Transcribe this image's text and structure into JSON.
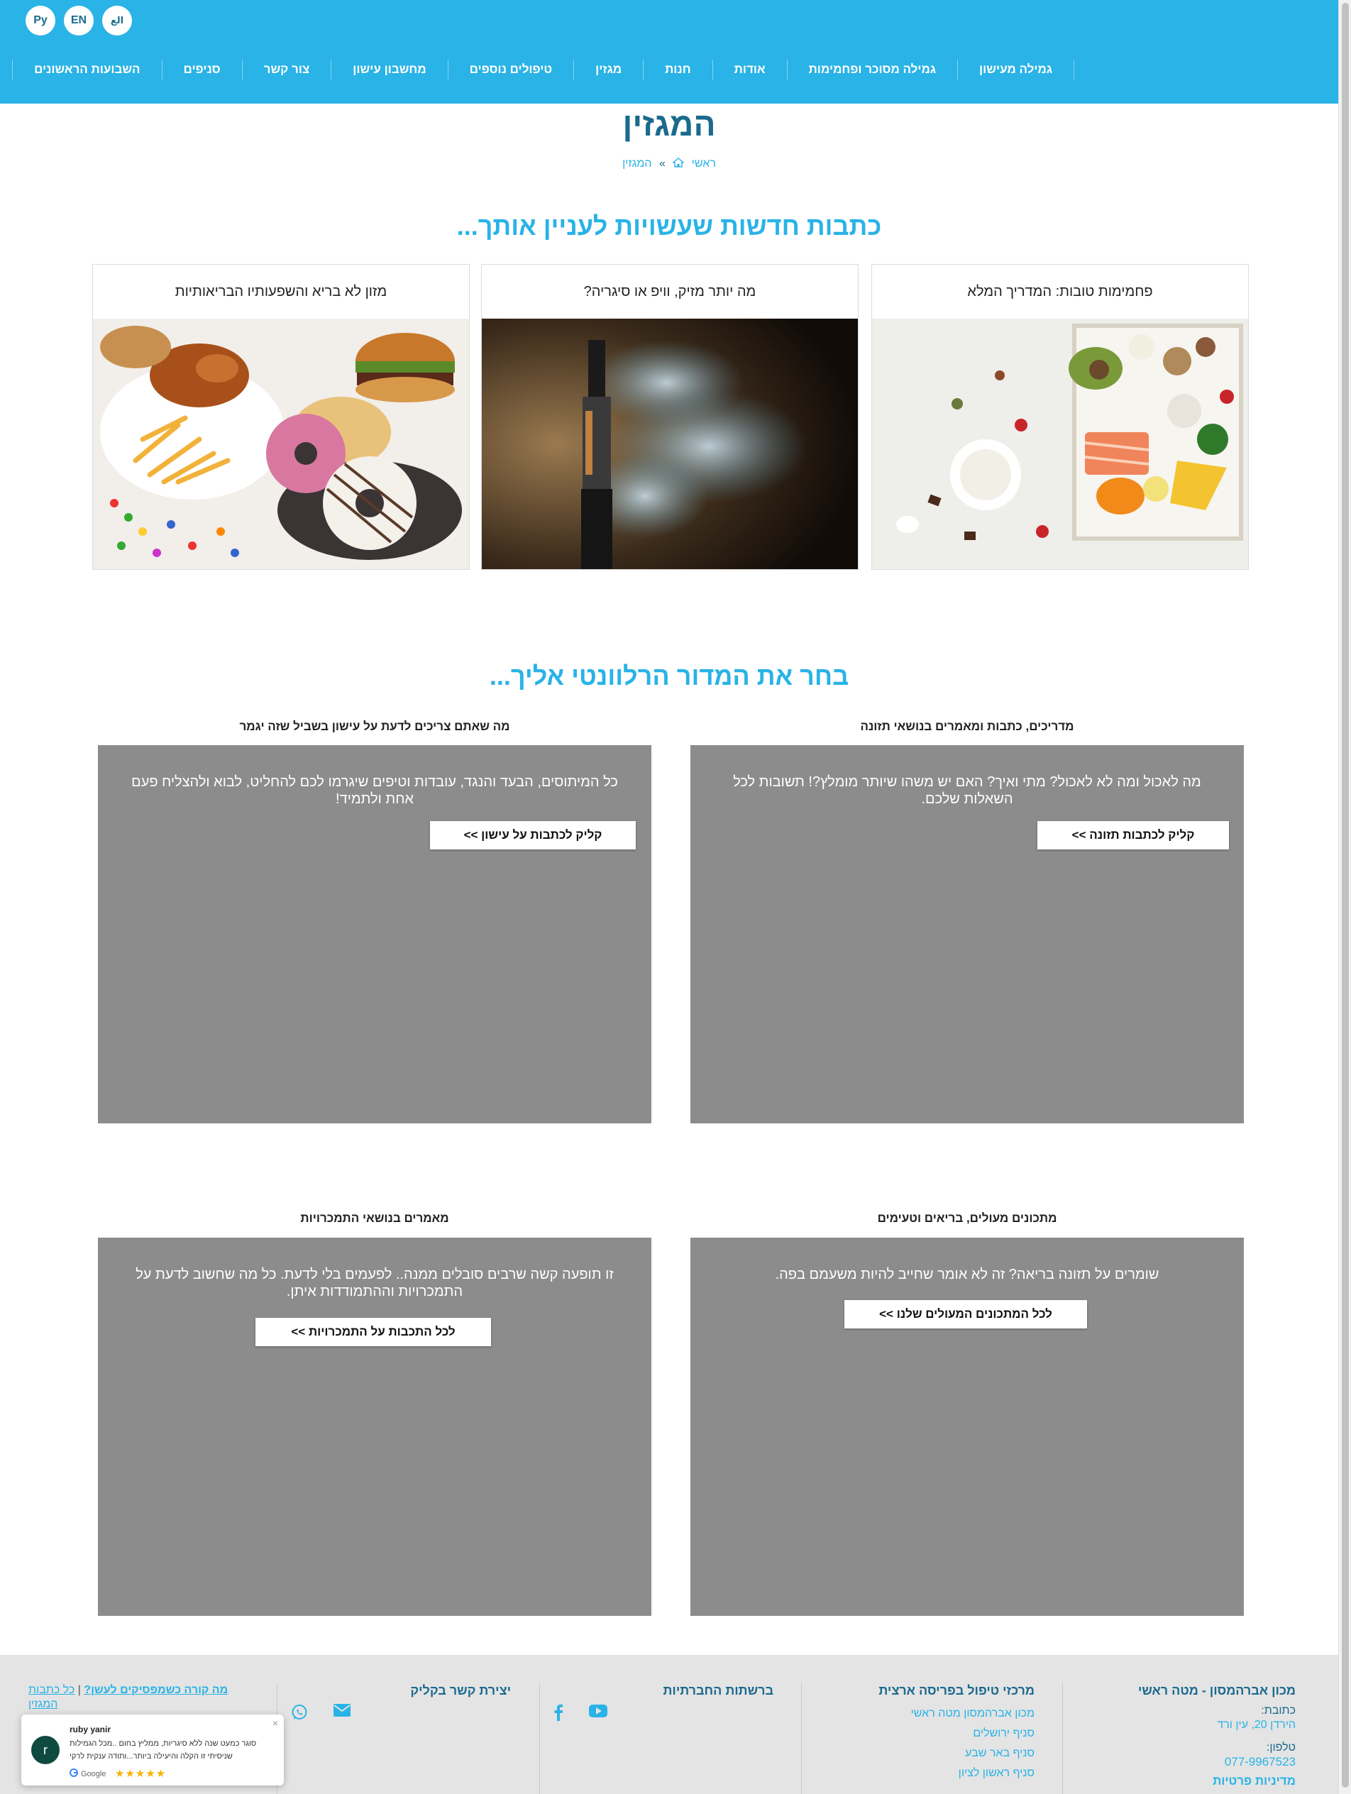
{
  "header": {
    "languages": [
      "Ру",
      "EN",
      "الع"
    ],
    "nav": [
      "גמילה מעישון",
      "גמילה מסוכר ופחמימות",
      "אודות",
      "חנות",
      "מגזין",
      "טיפולים נוספים",
      "מחשבון עישון",
      "צור קשר",
      "סניפים",
      "השבועות הראשונים"
    ]
  },
  "page": {
    "title": "המגזין",
    "breadcrumb": {
      "home": "ראשי",
      "separator": "»",
      "current": "המגזין"
    }
  },
  "latest": {
    "heading": "כתבות חדשות שעשויות לעניין אותך...",
    "articles": [
      {
        "title": "פחמימות טובות: המדריך המלא",
        "image": "healthy-food-photo"
      },
      {
        "title": "מה יותר מזיק, וויפ או סיגריה?",
        "image": "vape-smoke-photo"
      },
      {
        "title": "מזון לא בריא והשפעותיו הבריאותיות",
        "image": "junk-food-photo"
      }
    ]
  },
  "categories": {
    "heading": "בחר את המדור הרלוונטי אליך...",
    "items": [
      {
        "heading": "מדריכים, כתבות ומאמרים בנושאי תזונה",
        "desc": "מה לאכול ומה לא לאכול? מתי ואיך? האם יש משהו שיותר מומלץ?! תשובות לכל השאלות שלכם.",
        "button": "קליק לכתבות תזונה >>"
      },
      {
        "heading": "מה שאתם צריכים לדעת על עישון בשביל שזה יגמר",
        "desc": "כל המיתוסים, הבעד והנגד, עובדות וטיפים שיגרמו לכם להחליט, לבוא ולהצליח פעם אחת ולתמיד!",
        "button": "קליק לכתבות על עישון >>"
      },
      {
        "heading": "מתכונים מעולים, בריאים וטעימים",
        "desc": "שומרים על תזונה בריאה? זה לא אומר שחייב להיות משעמם בפה.",
        "button": "לכל המתכונים המעולים שלנו >>"
      },
      {
        "heading": "מאמרים בנושאי התמכרויות",
        "desc": "זו תופעה קשה שרבים סובלים ממנה.. לפעמים בלי לדעת. כל מה שחשוב לדעת על התמכרויות וההתמודדות איתן.",
        "button": "לכל התכבות על התמכרויות >>"
      }
    ]
  },
  "footer": {
    "main_office": {
      "heading": "מכון אברהמסון - מטה ראשי",
      "address_label": "כתובת:",
      "address": "הירדן 20, עין ורד",
      "phone_label": "טלפון:",
      "phone": "077-9967523",
      "privacy": "מדיניות פרטיות"
    },
    "centers": {
      "heading": "מרכזי טיפול בפריסה ארצית",
      "links": [
        "מכון אברהמסון מטה ראשי",
        "סניף ירושלים",
        "סניף באר שבע",
        "סניף ראשון לציון"
      ]
    },
    "social": {
      "heading": "ברשתות החברתיות",
      "icons": [
        "youtube-icon",
        "facebook-icon"
      ]
    },
    "contact": {
      "heading": "יצירת קשר בקליק",
      "icons": [
        "email-icon",
        "whatsapp-icon"
      ]
    },
    "links": {
      "text1": "מה קורה כשמפסיקים לעשן?",
      "divider": "|",
      "text2": "כל כתבות המגזין"
    }
  },
  "review_widget": {
    "avatar_letter": "r",
    "name": "ruby yanir",
    "text": "סוגר כמעט שנה ללא סיגריות, ממליץ בחום ..מכל הגמילות שניסיתי זו הקלה והיעילה ביותר...ותודה ענקית לרקי",
    "source": "Google",
    "stars": "★★★★★",
    "close": "×"
  },
  "colors": {
    "brand": "#29b3e6",
    "title": "#1b6a8e",
    "category_box": "#8c8c8c",
    "footer_bg": "#e4e4e4"
  }
}
